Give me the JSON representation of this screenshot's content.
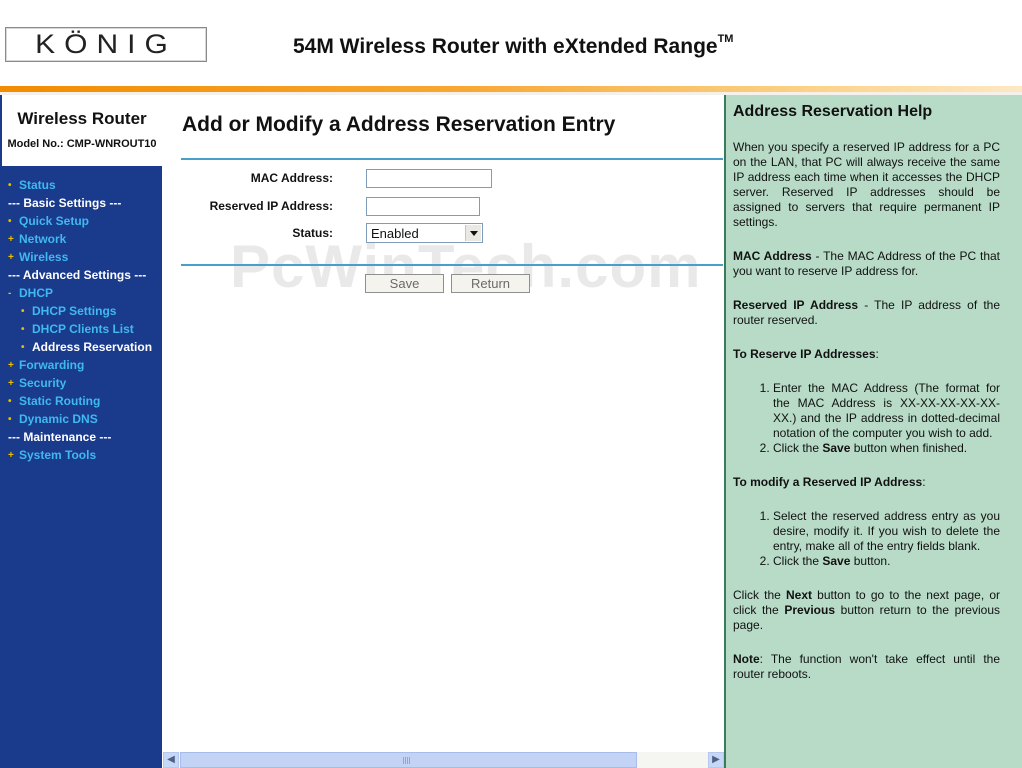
{
  "header": {
    "logo": "KÖNIG",
    "title": "54M Wireless Router with eXtended Range",
    "title_tm": "TM"
  },
  "sidebar": {
    "title": "Wireless Router",
    "model": "Model No.: CMP-WNROUT10",
    "items": [
      {
        "label": "Status",
        "type": "item",
        "marker": "•"
      },
      {
        "label": "--- Basic Settings ---",
        "type": "section"
      },
      {
        "label": "Quick Setup",
        "type": "item",
        "marker": "•"
      },
      {
        "label": "Network",
        "type": "item",
        "marker": "+"
      },
      {
        "label": "Wireless",
        "type": "item",
        "marker": "+"
      },
      {
        "label": "--- Advanced Settings ---",
        "type": "section"
      },
      {
        "label": "DHCP",
        "type": "item",
        "marker": "-"
      },
      {
        "label": "DHCP Settings",
        "type": "sub",
        "marker": "•"
      },
      {
        "label": "DHCP Clients List",
        "type": "sub",
        "marker": "•"
      },
      {
        "label": "Address Reservation",
        "type": "sub",
        "marker": "•",
        "active": true
      },
      {
        "label": "Forwarding",
        "type": "item",
        "marker": "+"
      },
      {
        "label": "Security",
        "type": "item",
        "marker": "+"
      },
      {
        "label": "Static Routing",
        "type": "item",
        "marker": "•"
      },
      {
        "label": "Dynamic DNS",
        "type": "item",
        "marker": "•"
      },
      {
        "label": "--- Maintenance ---",
        "type": "section"
      },
      {
        "label": "System Tools",
        "type": "item",
        "marker": "+"
      }
    ]
  },
  "main": {
    "title": "Add or Modify a Address Reservation Entry",
    "mac_label": "MAC Address:",
    "mac_value": "",
    "ip_label": "Reserved IP Address:",
    "ip_value": "",
    "status_label": "Status:",
    "status_value": "Enabled",
    "save_label": "Save",
    "return_label": "Return",
    "watermark": "PcWinTech.com"
  },
  "help": {
    "title": "Address Reservation Help",
    "intro": "When you specify a reserved IP address for a PC on the LAN, that PC will always receive the same IP address each time when it accesses the DHCP server. Reserved IP addresses should be assigned to servers that require permanent IP settings.",
    "mac_term": "MAC Address",
    "mac_desc": " - The MAC Address of the PC that you want to reserve IP address for.",
    "ip_term": "Reserved IP Address",
    "ip_desc": " - The IP address of the router reserved.",
    "reserve_heading": "To Reserve IP Addresses",
    "reserve_step1": "Enter the MAC Address (The format for the MAC Address is XX-XX-XX-XX-XX-XX.) and the IP address in dotted-decimal notation of the computer you wish to add.",
    "reserve_step2_pre": "Click the ",
    "reserve_step2_bold": "Save",
    "reserve_step2_post": " button when finished.",
    "modify_heading": "To modify a Reserved IP Address",
    "modify_step1": "Select the reserved address entry as you desire, modify it. If you wish to delete the entry, make all of the entry fields blank.",
    "modify_step2_pre": "Click the ",
    "modify_step2_bold": "Save",
    "modify_step2_post": " button.",
    "nav_pre": "Click the ",
    "nav_next": "Next",
    "nav_mid": " button to go to the next page, or click the ",
    "nav_prev": "Previous",
    "nav_post": " button return to the previous page.",
    "note_label": "Note",
    "note_text": ": The function won't take effect until the router reboots."
  },
  "colors": {
    "sidebar_bg": "#1a3a8c",
    "menu_link": "#3fb9f0",
    "help_bg": "#b7dbc7",
    "accent_orange": "#f28c00",
    "rule": "#4a9fc8"
  }
}
